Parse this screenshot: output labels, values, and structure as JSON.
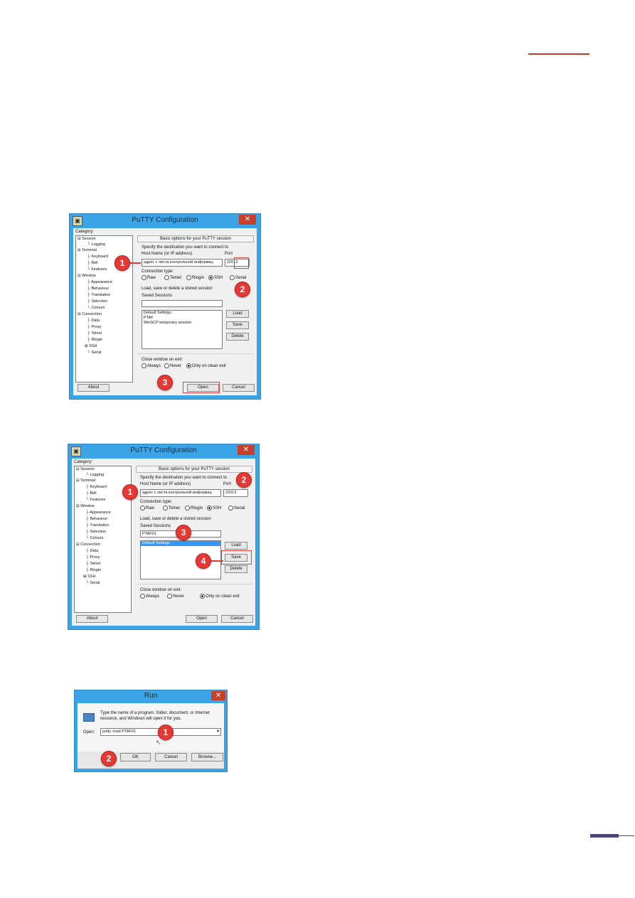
{
  "putty1": {
    "title": "PuTTY Configuration",
    "category_label": "Category:",
    "tree": [
      "Session",
      "Logging",
      "Terminal",
      "Keyboard",
      "Bell",
      "Features",
      "Window",
      "Appearance",
      "Behaviour",
      "Translation",
      "Selection",
      "Colours",
      "Connection",
      "Data",
      "Proxy",
      "Telnet",
      "Rlogin",
      "SSH",
      "Serial"
    ],
    "header": "Basic options for your PuTTY session",
    "specify": "Specify the destination you want to connect to",
    "host_label": "Host Name (or IP address)",
    "host_value": "адрес с листа контрольной информац",
    "port_label": "Port",
    "port_value": "22013",
    "conn_type_label": "Connection type:",
    "conn_types": [
      "Raw",
      "Telnet",
      "Rlogin",
      "SSH",
      "Serial"
    ],
    "load_save_label": "Load, save or delete a stored session",
    "saved_sessions_label": "Saved Sessions",
    "saved_sessions_value": "",
    "sessions": [
      "Default Settings",
      "PTAF",
      "WinSCP temporary session"
    ],
    "load_btn": "Load",
    "save_btn": "Save",
    "delete_btn": "Delete",
    "close_exit_label": "Close window on exit:",
    "close_opts": [
      "Always",
      "Never",
      "Only on clean exit"
    ],
    "about_btn": "About",
    "open_btn": "Open",
    "cancel_btn": "Cancel",
    "badges": [
      "1",
      "2",
      "3"
    ]
  },
  "putty2": {
    "title": "PuTTY Configuration",
    "category_label": "Category:",
    "tree": [
      "Session",
      "Logging",
      "Terminal",
      "Keyboard",
      "Bell",
      "Features",
      "Window",
      "Appearance",
      "Behaviour",
      "Translation",
      "Selection",
      "Colours",
      "Connection",
      "Data",
      "Proxy",
      "Telnet",
      "Rlogin",
      "SSH",
      "Serial"
    ],
    "header": "Basic options for your PuTTY session",
    "specify": "Specify the destination you want to connect to",
    "host_label": "Host Name (or IP address)",
    "host_value": "адрес с листа контрольной информац",
    "port_label": "Port",
    "port_value": "22013",
    "conn_type_label": "Connection type:",
    "conn_types": [
      "Raw",
      "Telnet",
      "Rlogin",
      "SSH",
      "Serial"
    ],
    "load_save_label": "Load, save or delete a stored session",
    "saved_sessions_label": "Saved Sessions",
    "saved_sessions_value": "PTAF01",
    "sessions": [
      "Default Settings"
    ],
    "load_btn": "Load",
    "save_btn": "Save",
    "delete_btn": "Delete",
    "close_exit_label": "Close window on exit:",
    "close_opts": [
      "Always",
      "Never",
      "Only on clean exit"
    ],
    "about_btn": "About",
    "open_btn": "Open",
    "cancel_btn": "Cancel",
    "badges": [
      "1",
      "2",
      "3",
      "4"
    ]
  },
  "run": {
    "title": "Run",
    "description": "Type the name of a program, folder, document, or Internet resource, and Windows will open it for you.",
    "open_label": "Open:",
    "open_value": "putty -load PTAF01",
    "ok_btn": "OK",
    "cancel_btn": "Cancel",
    "browse_btn": "Browse...",
    "badges": [
      "1",
      "2"
    ]
  },
  "colors": {
    "accent": "#e53935",
    "titlebar": "#3aa4e6",
    "close": "#c7402c",
    "bar": "#4a4580"
  }
}
